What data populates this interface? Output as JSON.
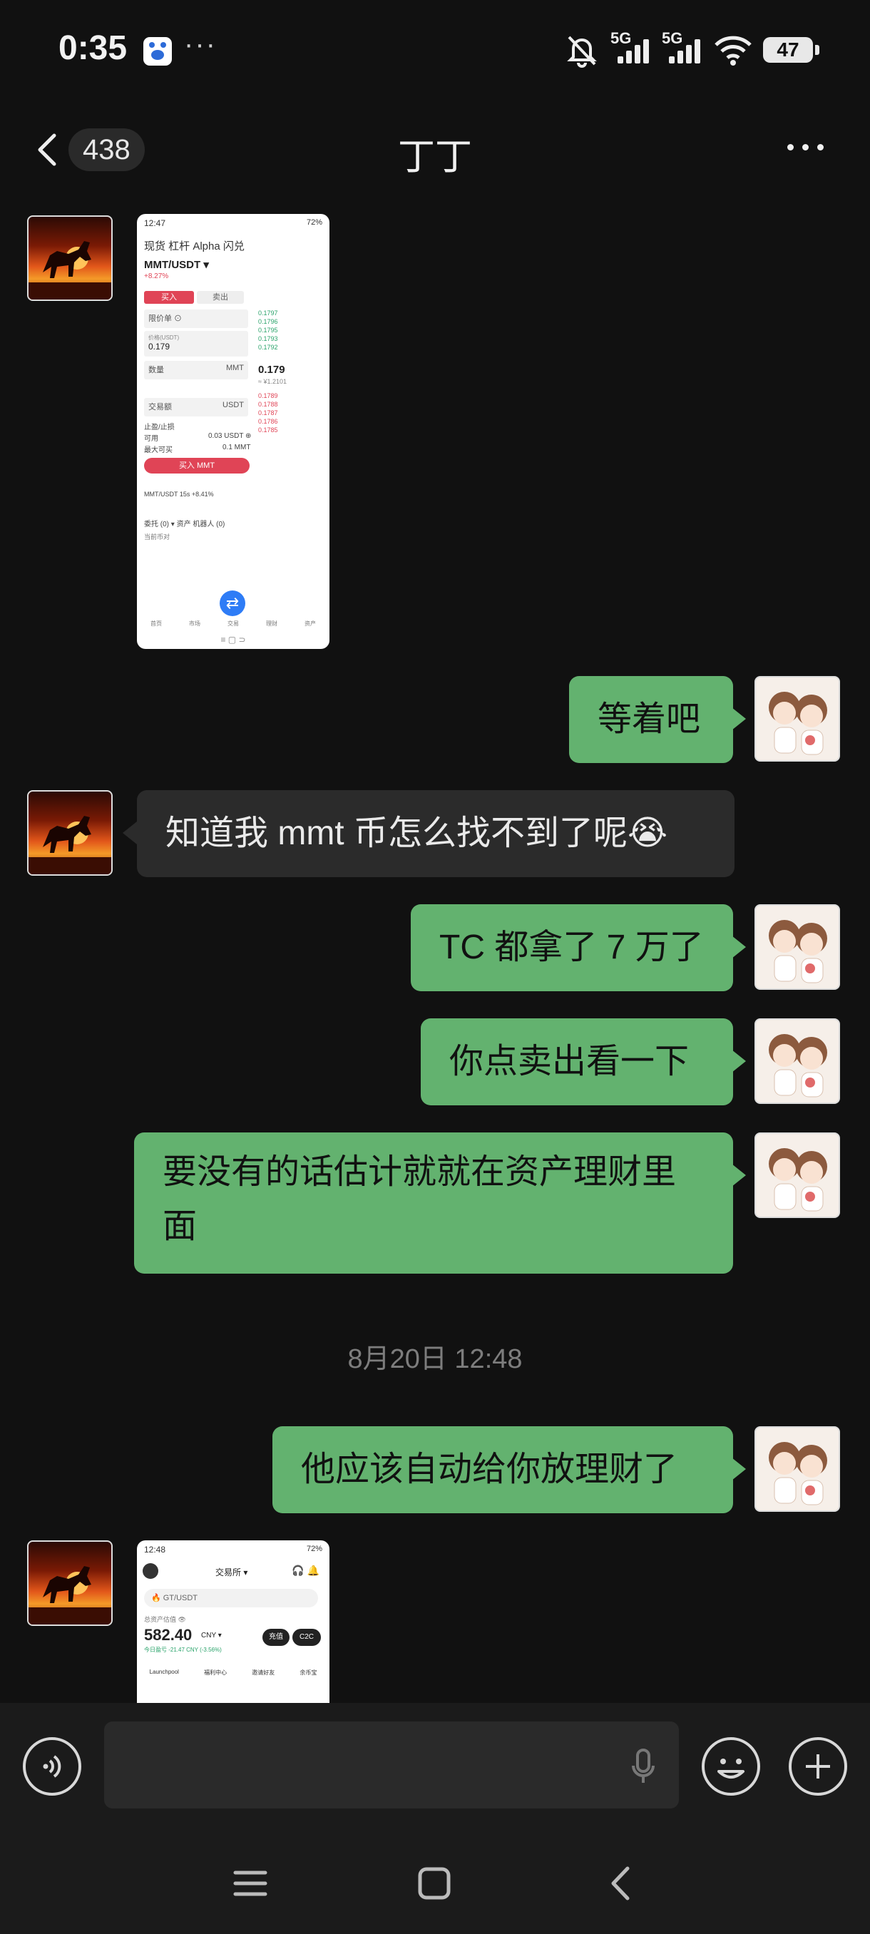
{
  "status_bar": {
    "time": "0:35",
    "more": "···",
    "signal1_label": "5G",
    "signal2_label": "5G",
    "battery": "47"
  },
  "header": {
    "unread_count": "438",
    "title": "丁丁"
  },
  "messages": [
    {
      "side": "left",
      "type": "image"
    },
    {
      "side": "right",
      "type": "text",
      "text": "等着吧"
    },
    {
      "side": "left",
      "type": "text",
      "text": "知道我 mmt 币怎么找不到了呢😭"
    },
    {
      "side": "right",
      "type": "text",
      "text": "TC 都拿了 7 万了"
    },
    {
      "side": "right",
      "type": "text",
      "text": "你点卖出看一下"
    },
    {
      "side": "right",
      "type": "text",
      "text": "要没有的话估计就就在资产理财里面"
    },
    {
      "side": "right",
      "type": "text",
      "text": "他应该自动给你放理财了"
    },
    {
      "side": "left",
      "type": "image"
    }
  ],
  "timestamp": "8月20日 12:48",
  "shot1": {
    "time": "12:47",
    "battery": "72%",
    "tabs": "现货  杠杆  Alpha  闪兑",
    "pair": "MMT/USDT ▾",
    "change": "+8.27%",
    "buy_tab": "买入",
    "sell_tab": "卖出",
    "order_type": "限价单 ⊙",
    "price_label": "价格(USDT)",
    "price_value": "0.179",
    "qty_label": "数量",
    "qty_unit": "MMT",
    "amount_label": "交易额",
    "amount_unit": "USDT",
    "tp_sl": "止盈/止损",
    "avail_label": "可用",
    "avail_value": "0.03 USDT ⊕",
    "max_label": "最大可买",
    "max_value": "0.1 MMT",
    "buy_button": "买入 MMT",
    "mid_price": "0.179",
    "mid_cny": "≈ ¥1.2101",
    "pair_bar": "MMT/USDT 15s +8.41%",
    "orders_tabs": "委托 (0) ▾   资产   机器人 (0)",
    "current_pair": "当前币对",
    "ob_green": [
      "0.1797",
      "0.1796",
      "0.1795",
      "0.1793",
      "0.1792"
    ],
    "ob_red": [
      "0.1789",
      "0.1788",
      "0.1787",
      "0.1786",
      "0.1785"
    ],
    "nav": [
      "首页",
      "市场",
      "交易",
      "理财",
      "资产"
    ]
  },
  "shot2": {
    "time": "12:48",
    "battery": "72%",
    "exchange_tab": "交易所 ▾",
    "search_placeholder": "🔥 GT/USDT",
    "total_label": "总资产估值 👁",
    "total_value": "582.40",
    "currency": "CNY ▾",
    "today_pnl": "今日盈亏 -21.47 CNY (-3.56%)",
    "deposit": "充值",
    "c2c": "C2C",
    "shortcuts": [
      "Launchpool",
      "福利中心",
      "邀请好友",
      "余币宝"
    ]
  }
}
